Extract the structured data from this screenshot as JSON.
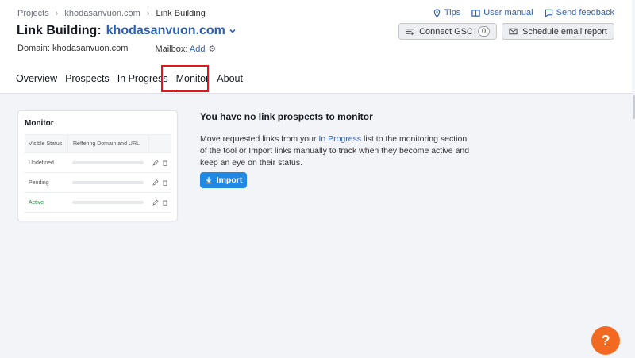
{
  "breadcrumb": {
    "items": [
      "Projects",
      "khodasanvuon.com",
      "Link Building"
    ]
  },
  "toplinks": {
    "tips": "Tips",
    "manual": "User manual",
    "feedback": "Send feedback"
  },
  "title": {
    "prefix": "Link Building:",
    "domain": "khodasanvuon.com"
  },
  "actions": {
    "connect_gsc": "Connect GSC",
    "gsc_count": "0",
    "schedule": "Schedule email report"
  },
  "meta": {
    "domain_label": "Domain:",
    "domain_value": "khodasanvuon.com",
    "mailbox_label": "Mailbox:",
    "mailbox_add": "Add"
  },
  "tabs": [
    "Overview",
    "Prospects",
    "In Progress",
    "Monitor",
    "About"
  ],
  "active_tab": "Monitor",
  "card": {
    "title": "Monitor",
    "headers": [
      "Visible Status",
      "Reffering Domain and URL"
    ],
    "rows": [
      {
        "status": "Undefined"
      },
      {
        "status": "Pending"
      },
      {
        "status": "Active"
      }
    ]
  },
  "empty": {
    "heading": "You have no link prospects to monitor",
    "text_before": "Move requested links from your ",
    "text_link": "In Progress",
    "text_after": " list to the monitoring section of the tool or Import links manually to track when they become active and keep an eye on their status.",
    "import_label": "Import"
  },
  "help": {
    "label": "?"
  },
  "colors": {
    "accent": "#2b5fb8",
    "import": "#1f89e5",
    "help": "#f26a21",
    "highlight": "#e0171b",
    "active_status": "#17913e"
  }
}
